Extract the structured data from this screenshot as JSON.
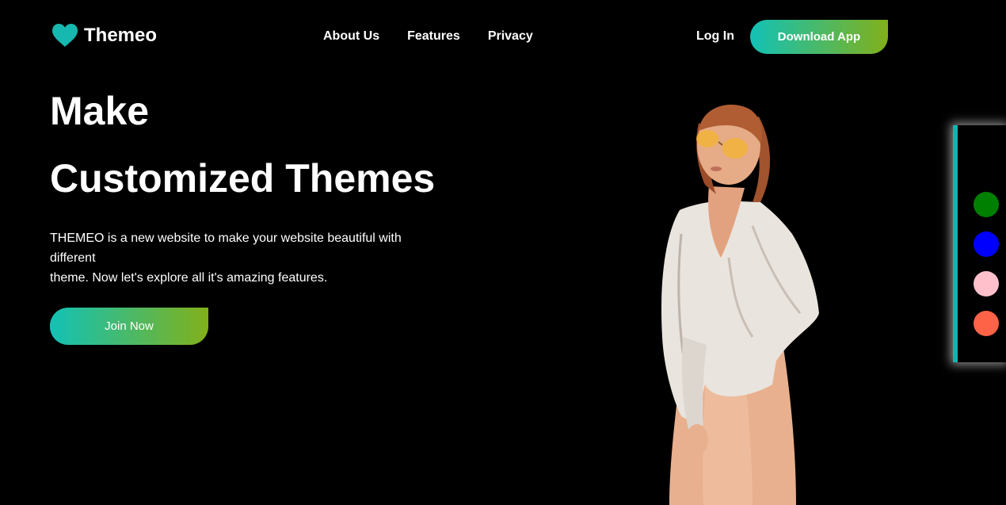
{
  "header": {
    "brand_name": "Themeo",
    "brand_icon": "heart-icon",
    "nav": [
      "About Us",
      "Features",
      "Privacy"
    ],
    "login_label": "Log In",
    "download_label": "Download App"
  },
  "hero": {
    "line1": "Make",
    "line2": "Customized Themes",
    "description_lines": [
      "THEMEO is a new website to make your website beautiful with",
      "different",
      "theme. Now let's explore all it's amazing features."
    ],
    "join_label": "Join Now"
  },
  "theme_palette": {
    "swatches": [
      "#000000",
      "#008000",
      "#0000ff",
      "#ffc0cb",
      "#ff6347"
    ]
  },
  "colors": {
    "accent_start": "#12c2b6",
    "accent_end": "#82b01a",
    "heart": "#17b8b0",
    "palette_border": "#12b5ac"
  }
}
